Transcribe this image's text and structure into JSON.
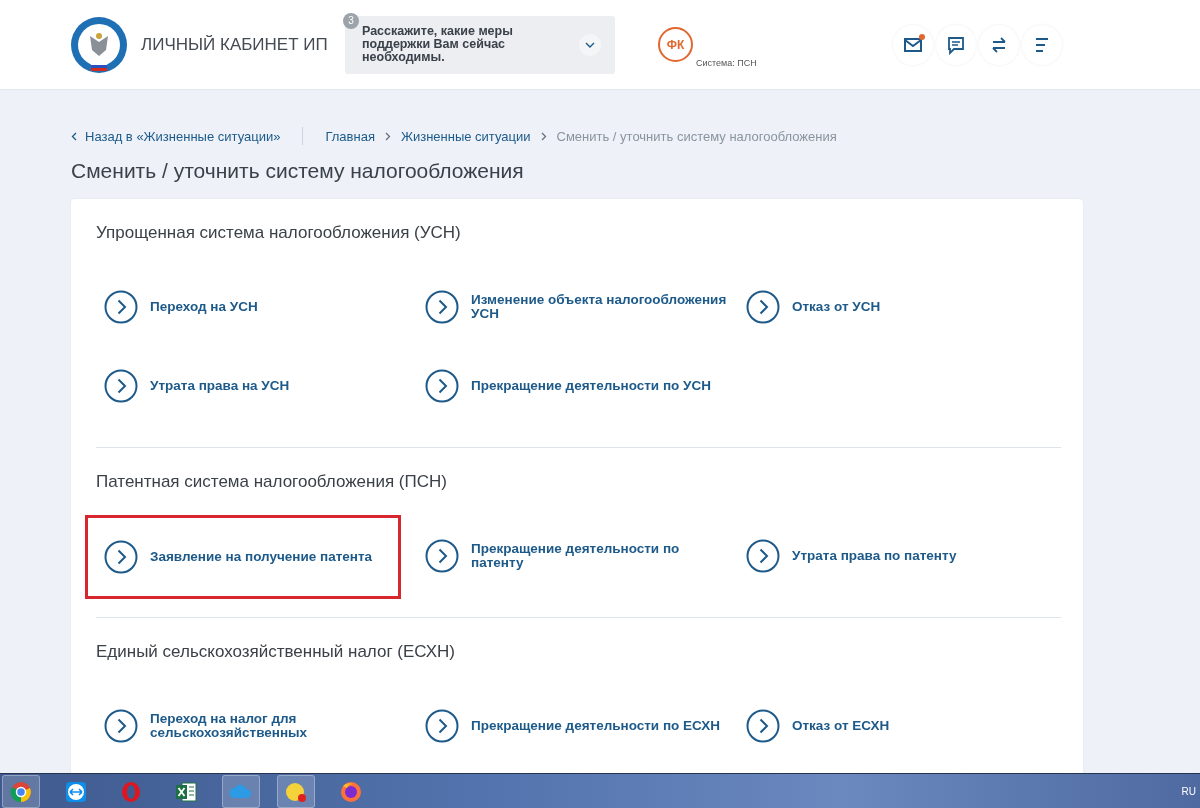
{
  "header": {
    "title": "ЛИЧНЫЙ КАБИНЕТ ИП",
    "notice": {
      "badge": "3",
      "text": "Расскажите, какие меры поддержки Вам сейчас необходимы."
    },
    "avatar": {
      "initials": "ФК",
      "system": "Система: ПСН"
    },
    "mail_unread": true
  },
  "breadcrumb": {
    "back": "Назад в «Жизненные ситуации»",
    "items": [
      {
        "label": "Главная",
        "current": false
      },
      {
        "label": "Жизненные ситуации",
        "current": false
      },
      {
        "label": "Сменить / уточнить систему налогообложения",
        "current": true
      }
    ]
  },
  "page_title": "Сменить / уточнить систему налогообложения",
  "sections": [
    {
      "title": "Упрощенная система налогообложения (УСН)",
      "items": [
        {
          "label": "Переход на УСН",
          "highlighted": false
        },
        {
          "label": "Изменение объекта налогообложения УСН",
          "highlighted": false
        },
        {
          "label": "Отказ от УСН",
          "highlighted": false
        },
        {
          "label": "Утрата права на УСН",
          "highlighted": false
        },
        {
          "label": "Прекращение деятельности по УСН",
          "highlighted": false
        }
      ]
    },
    {
      "title": "Патентная система налогообложения (ПСН)",
      "items": [
        {
          "label": "Заявление на получение патента",
          "highlighted": true
        },
        {
          "label": "Прекращение деятельности по патенту",
          "highlighted": false
        },
        {
          "label": "Утрата права по патенту",
          "highlighted": false
        }
      ]
    },
    {
      "title": "Единый сельскохозяйственный налог (ЕСХН)",
      "items": [
        {
          "label": "Переход на налог для сельскохозяйственных",
          "highlighted": false
        },
        {
          "label": "Прекращение деятельности по ЕСХН",
          "highlighted": false
        },
        {
          "label": "Отказ от ЕСХН",
          "highlighted": false
        }
      ]
    }
  ],
  "taskbar": {
    "apps": [
      {
        "active": true
      },
      {
        "active": false
      },
      {
        "active": false
      },
      {
        "active": false
      },
      {
        "active": true
      },
      {
        "active": true
      },
      {
        "active": false
      }
    ],
    "language": "RU"
  }
}
